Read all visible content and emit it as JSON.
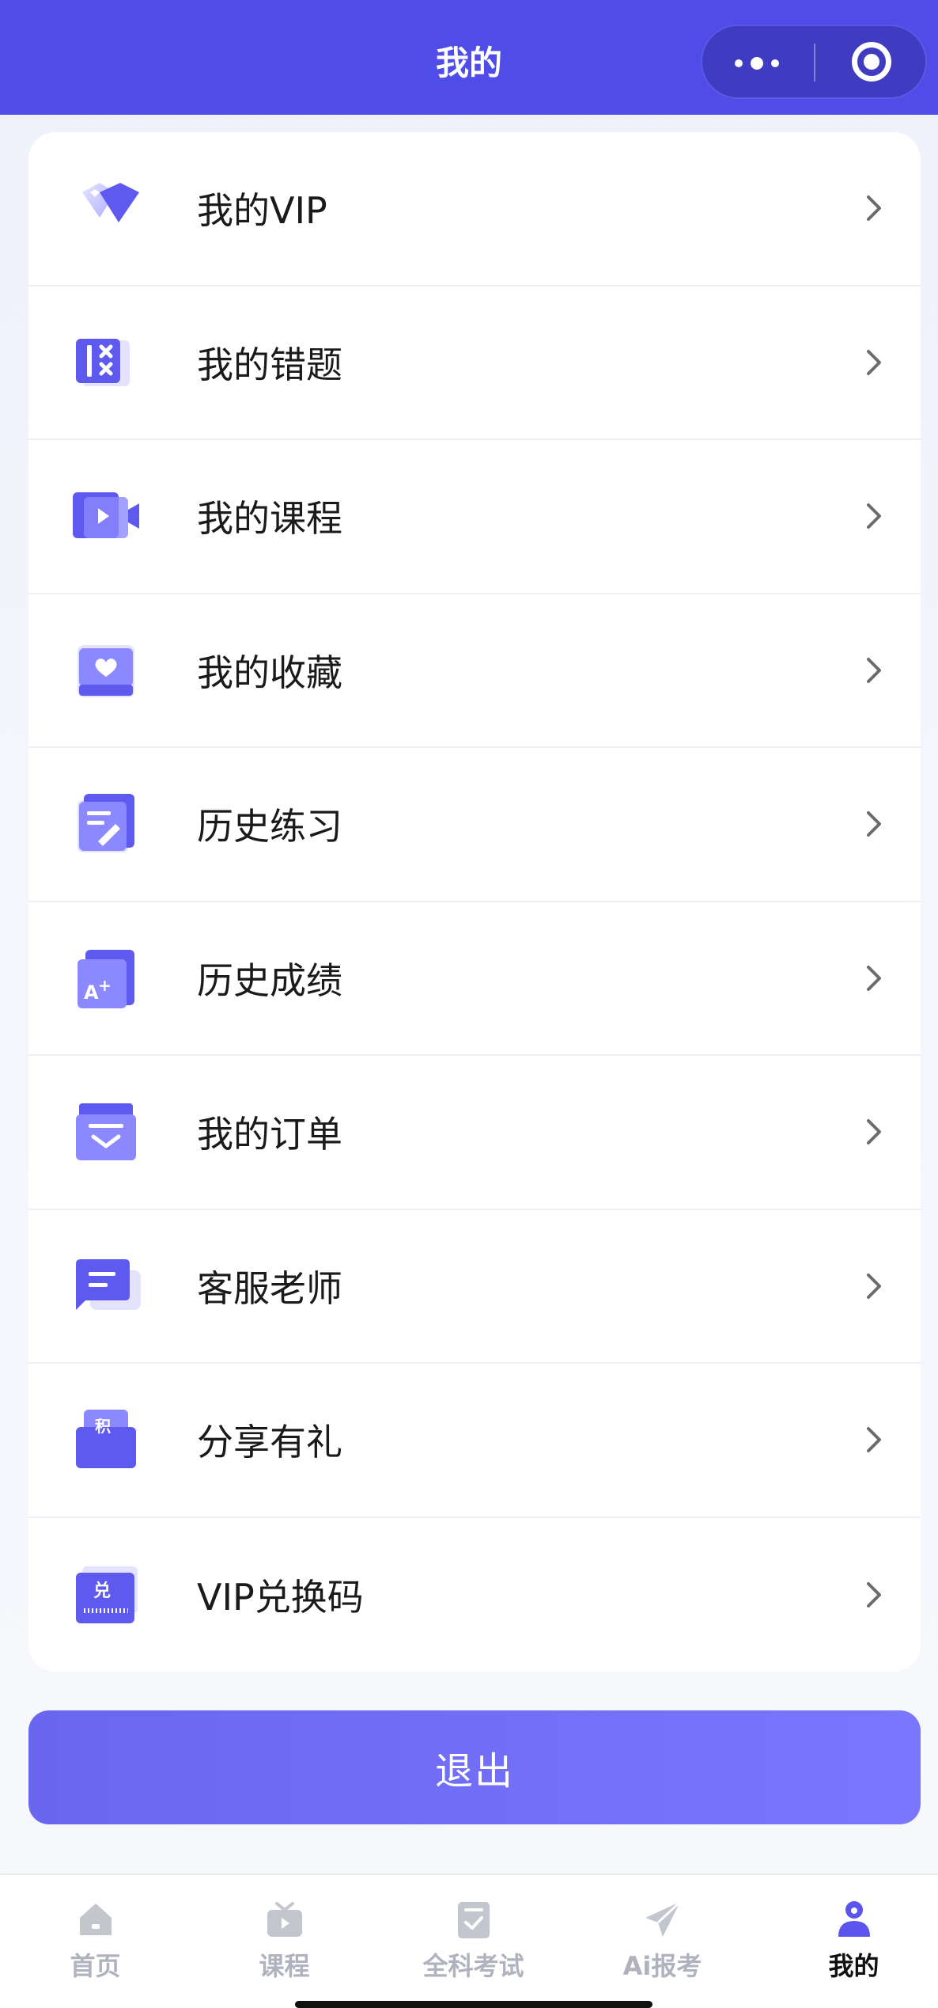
{
  "header": {
    "title": "我的",
    "more_icon": "more-dots-icon",
    "close_icon": "target-close-icon"
  },
  "menu": {
    "items": [
      {
        "label": "我的VIP",
        "icon": "diamond-icon"
      },
      {
        "label": "我的错题",
        "icon": "wrong-answers-icon"
      },
      {
        "label": "我的课程",
        "icon": "video-course-icon"
      },
      {
        "label": "我的收藏",
        "icon": "heart-favorite-icon"
      },
      {
        "label": "历史练习",
        "icon": "practice-edit-icon"
      },
      {
        "label": "历史成绩",
        "icon": "grade-a-plus-icon"
      },
      {
        "label": "我的订单",
        "icon": "order-box-icon"
      },
      {
        "label": "客服老师",
        "icon": "chat-service-icon"
      },
      {
        "label": "分享有礼",
        "icon": "share-gift-icon"
      },
      {
        "label": "VIP兑换码",
        "icon": "redeem-code-icon"
      }
    ]
  },
  "actions": {
    "logout_label": "退出"
  },
  "tabbar": {
    "tabs": [
      {
        "label": "首页",
        "icon": "home-icon",
        "active": false
      },
      {
        "label": "课程",
        "icon": "tv-course-icon",
        "active": false
      },
      {
        "label": "全科考试",
        "icon": "exam-check-icon",
        "active": false
      },
      {
        "label": "Ai报考",
        "icon": "paper-plane-icon",
        "active": false
      },
      {
        "label": "我的",
        "icon": "user-profile-icon",
        "active": true
      }
    ]
  },
  "colors": {
    "brand": "#4f4ce8",
    "button": "#716df6",
    "tab_inactive": "#b0b3bd",
    "tab_active": "#111111",
    "active_icon": "#5b55ee"
  }
}
